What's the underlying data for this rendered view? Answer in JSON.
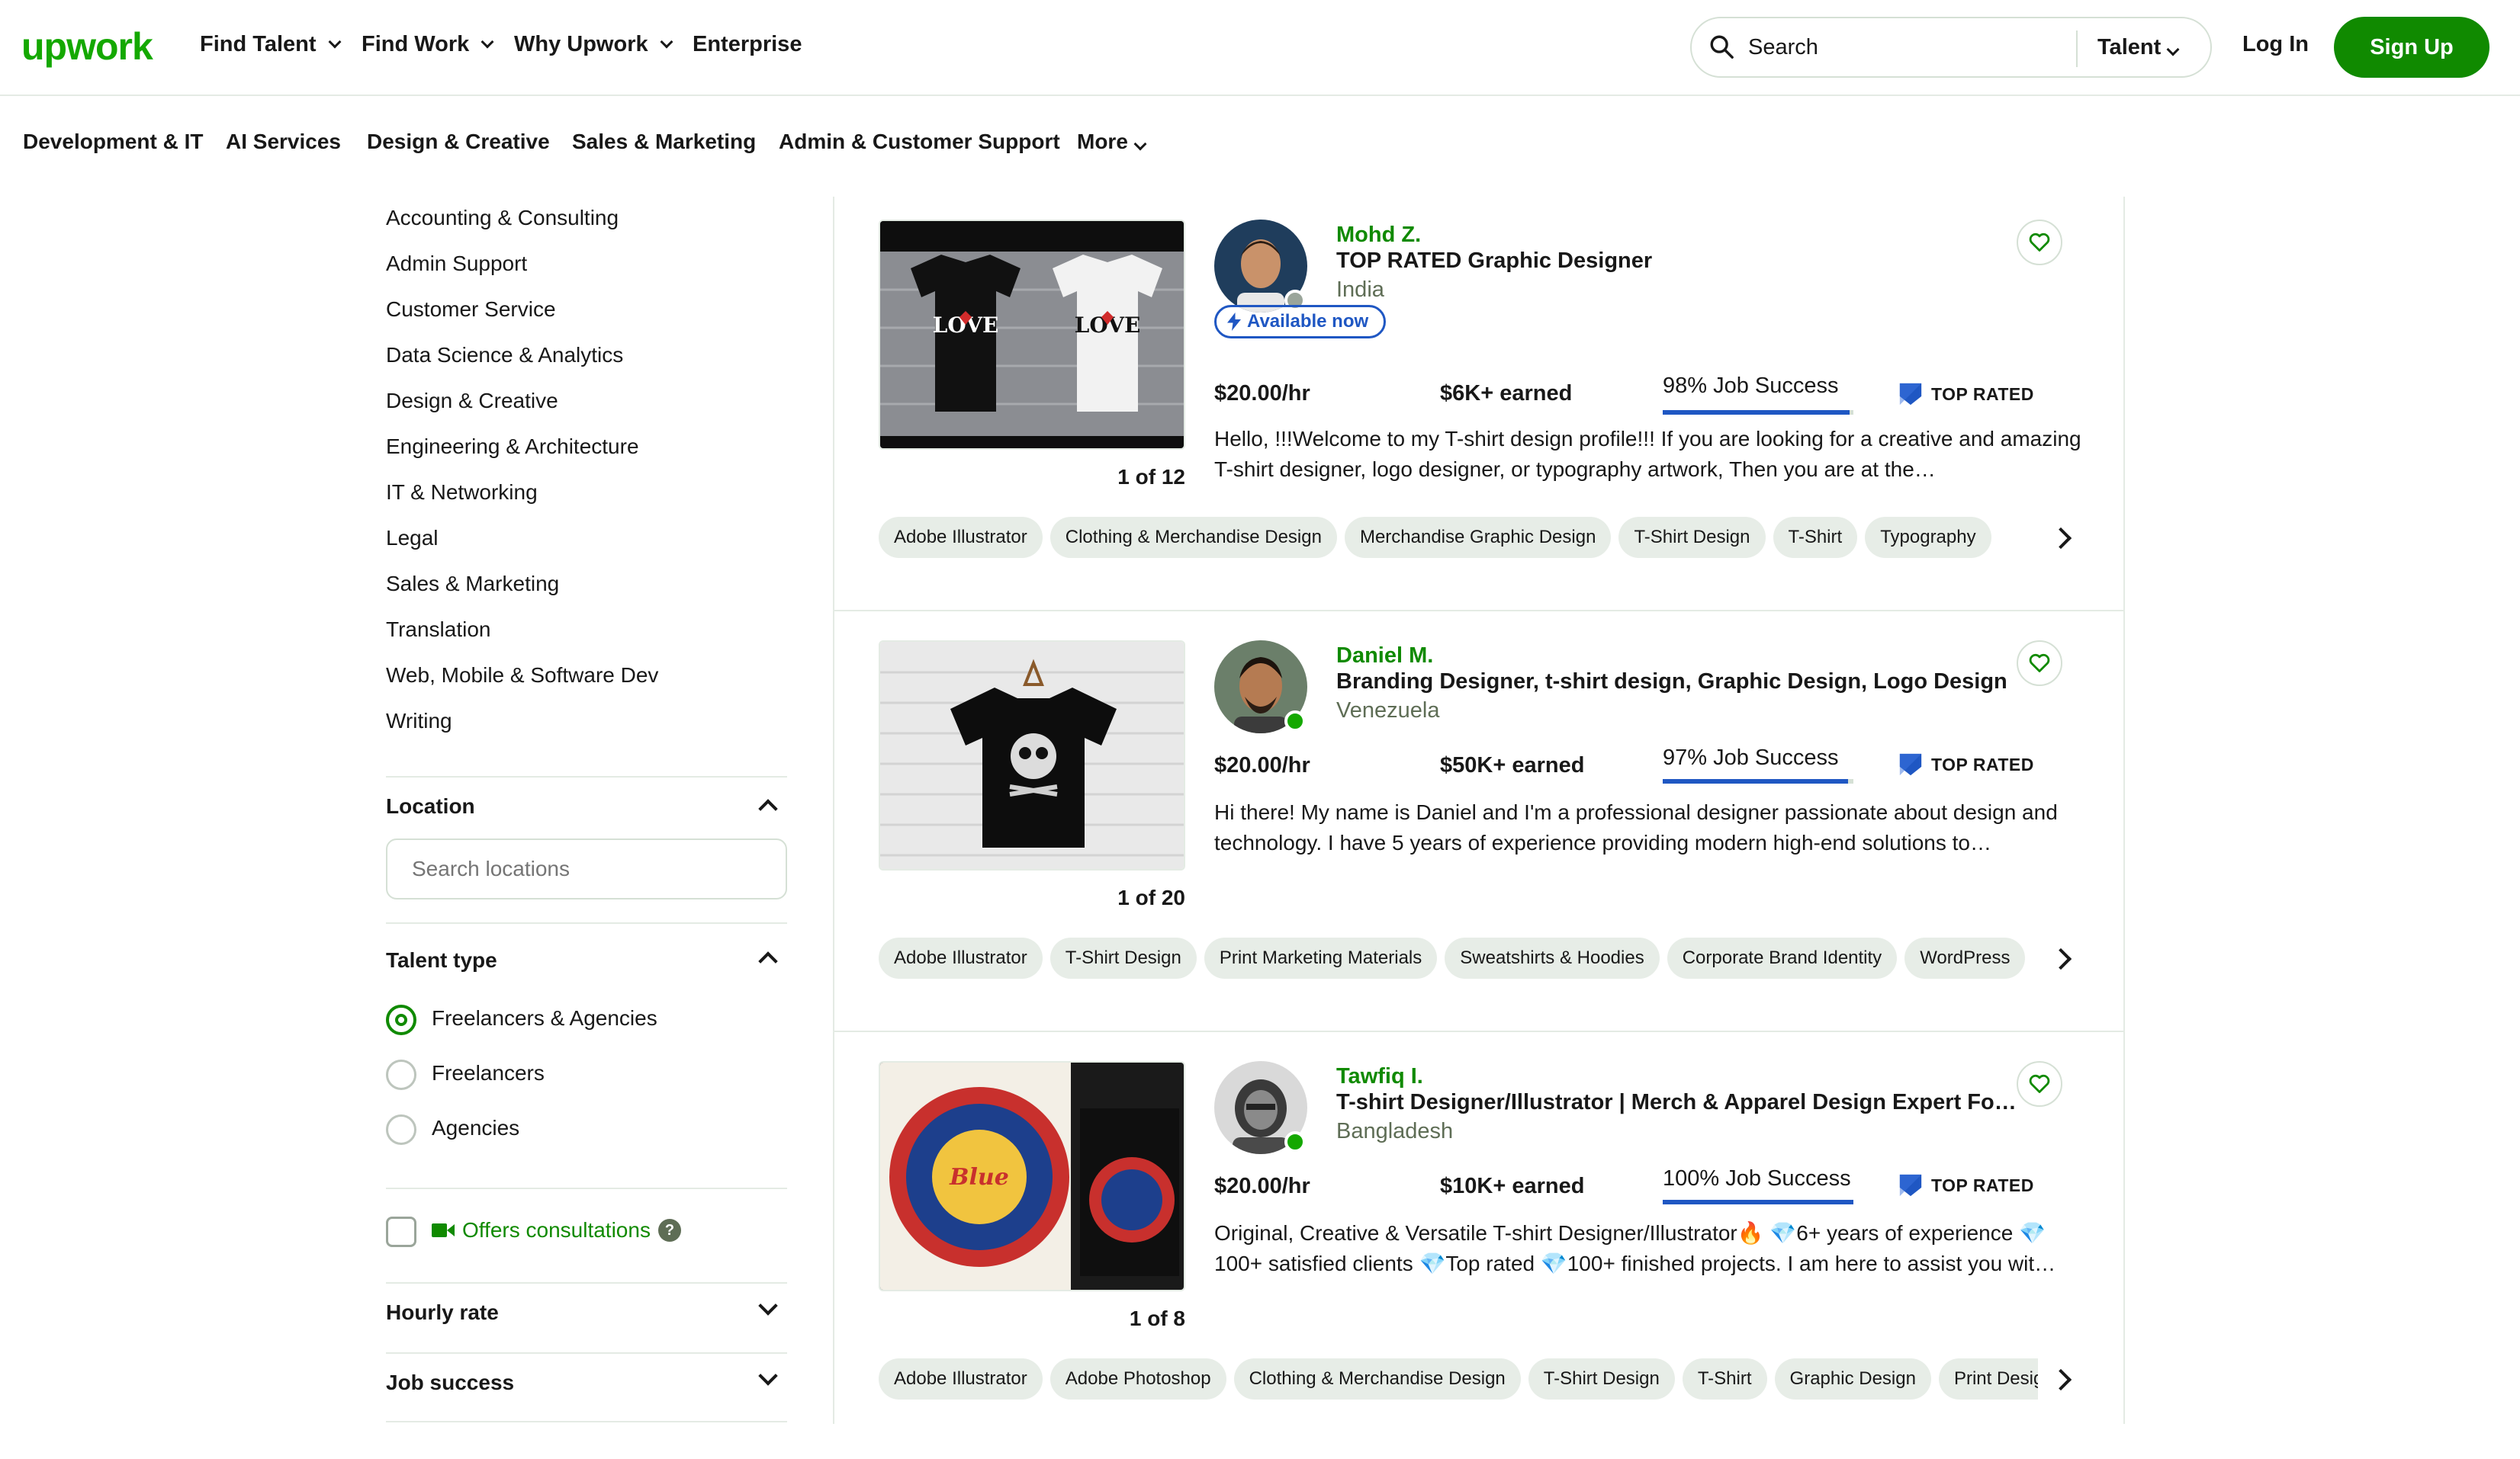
{
  "header": {
    "logo": "upwork",
    "nav": [
      "Find Talent",
      "Find Work",
      "Why Upwork",
      "Enterprise"
    ],
    "search_label": "Search",
    "search_scope": "Talent",
    "login": "Log In",
    "signup": "Sign Up",
    "brand_color": "#108a00"
  },
  "categories": [
    "Development & IT",
    "AI Services",
    "Design & Creative",
    "Sales & Marketing",
    "Admin & Customer Support",
    "More"
  ],
  "sidebar": {
    "categories": [
      "Accounting & Consulting",
      "Admin Support",
      "Customer Service",
      "Data Science & Analytics",
      "Design & Creative",
      "Engineering & Architecture",
      "IT & Networking",
      "Legal",
      "Sales & Marketing",
      "Translation",
      "Web, Mobile & Software Dev",
      "Writing"
    ],
    "location_title": "Location",
    "location_placeholder": "Search locations",
    "talent_type_title": "Talent type",
    "talent_types": [
      "Freelancers & Agencies",
      "Freelancers",
      "Agencies"
    ],
    "selected_talent_type": "Freelancers & Agencies",
    "offers_consultations": "Offers consultations",
    "hourly_rate_title": "Hourly rate",
    "job_success_title": "Job success"
  },
  "results": [
    {
      "name": "Mohd Z.",
      "title": "TOP RATED Graphic Designer",
      "country": "India",
      "available": "Available now",
      "rate": "$20.00/hr",
      "earned": "$6K+ earned",
      "job_success": "98% Job Success",
      "job_success_pct": 98,
      "badge": "TOP RATED",
      "description": "Hello, !!!Welcome to my T-shirt design profile!!! If you are looking for a creative and amazing T-shirt designer, logo designer, or typography artwork, Then you are at the…",
      "counter": "1 of 12",
      "thumb_text": "LOVE",
      "skills": [
        "Adobe Illustrator",
        "Clothing & Merchandise Design",
        "Merchandise Graphic Design",
        "T-Shirt Design",
        "T-Shirt",
        "Typography"
      ]
    },
    {
      "name": "Daniel M.",
      "title": "Branding Designer, t-shirt design, Graphic Design, Logo Design",
      "country": "Venezuela",
      "rate": "$20.00/hr",
      "earned": "$50K+ earned",
      "job_success": "97% Job Success",
      "job_success_pct": 97,
      "badge": "TOP RATED",
      "description": "Hi there! My name is Daniel and I'm a professional designer passionate about design and technology. I have 5 years of experience providing modern high-end solutions to…",
      "counter": "1 of 20",
      "skills": [
        "Adobe Illustrator",
        "T-Shirt Design",
        "Print Marketing Materials",
        "Sweatshirts & Hoodies",
        "Corporate Brand Identity",
        "WordPress"
      ]
    },
    {
      "name": "Tawfiq I.",
      "title": "T-shirt Designer/Illustrator | Merch & Apparel Design Expert For Br…",
      "country": "Bangladesh",
      "rate": "$20.00/hr",
      "earned": "$10K+ earned",
      "job_success": "100% Job Success",
      "job_success_pct": 100,
      "badge": "TOP RATED",
      "description": "Original, Creative & Versatile T-shirt Designer/Illustrator🔥 💎6+ years of experience 💎 100+ satisfied clients 💎Top rated 💎100+ finished projects. I am here to assist you wit…",
      "counter": "1 of 8",
      "skills": [
        "Adobe Illustrator",
        "Adobe Photoshop",
        "Clothing & Merchandise Design",
        "T-Shirt Design",
        "T-Shirt",
        "Graphic Design",
        "Print Design"
      ]
    }
  ]
}
